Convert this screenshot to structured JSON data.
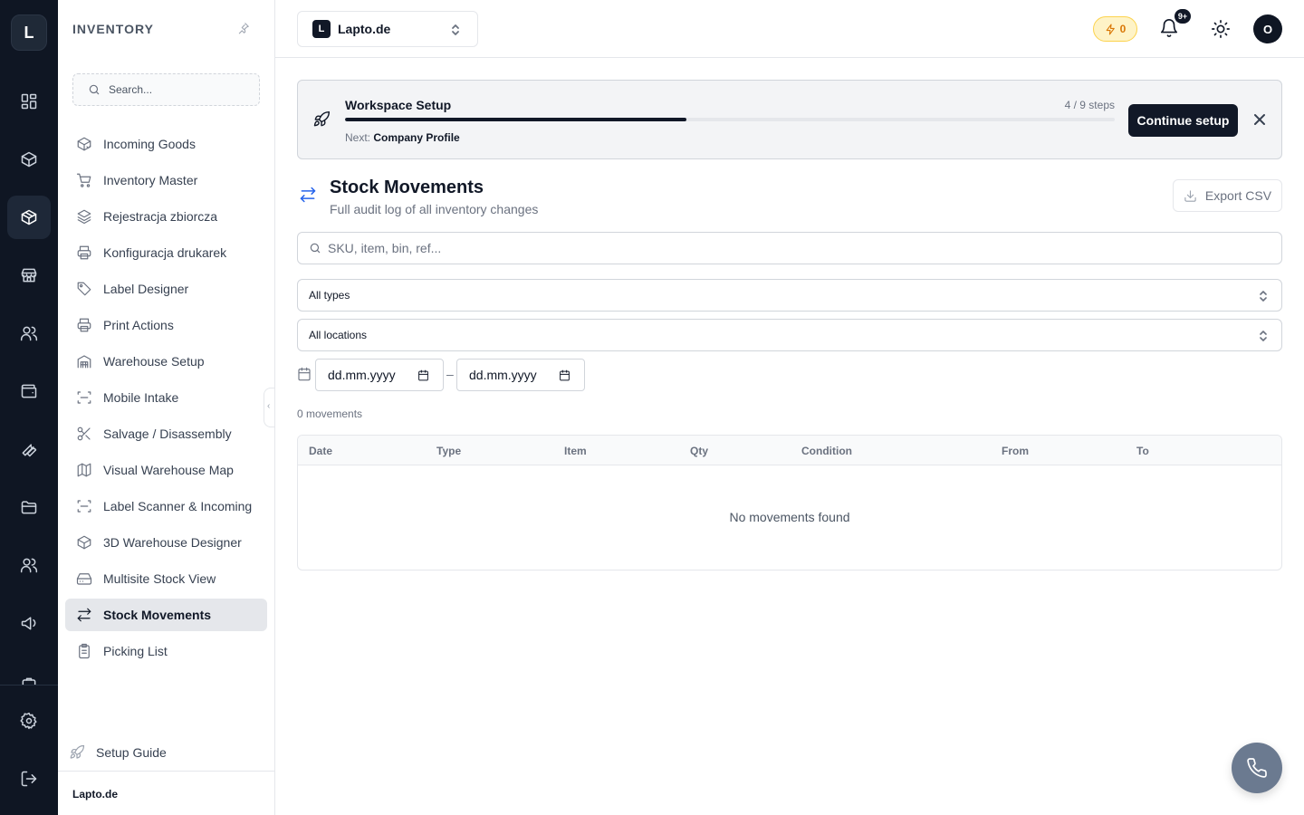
{
  "rail": {
    "logo_letter": "L",
    "items": [
      {
        "icon": "dashboard-icon"
      },
      {
        "icon": "box-icon"
      },
      {
        "icon": "inventory-box-icon",
        "active": true
      },
      {
        "icon": "store-icon"
      },
      {
        "icon": "users-icon"
      },
      {
        "icon": "wallet-icon"
      },
      {
        "icon": "wrench-icon"
      },
      {
        "icon": "folder-icon"
      },
      {
        "icon": "team-icon"
      },
      {
        "icon": "megaphone-icon"
      },
      {
        "icon": "settings-icon"
      },
      {
        "icon": "logout-icon"
      }
    ]
  },
  "sidebar": {
    "title": "INVENTORY",
    "search_placeholder": "Search...",
    "items": [
      {
        "label": "Incoming Goods",
        "icon": "package-incoming-icon"
      },
      {
        "label": "Inventory Master",
        "icon": "cart-icon"
      },
      {
        "label": "Rejestracja zbiorcza",
        "icon": "layers-icon"
      },
      {
        "label": "Konfiguracja drukarek",
        "icon": "printer-icon"
      },
      {
        "label": "Label Designer",
        "icon": "tag-icon"
      },
      {
        "label": "Print Actions",
        "icon": "printer-icon"
      },
      {
        "label": "Warehouse Setup",
        "icon": "building-icon"
      },
      {
        "label": "Mobile Intake",
        "icon": "scan-icon"
      },
      {
        "label": "Salvage / Disassembly",
        "icon": "scissors-icon"
      },
      {
        "label": "Visual Warehouse Map",
        "icon": "map-icon"
      },
      {
        "label": "Label Scanner & Incoming",
        "icon": "scan-icon"
      },
      {
        "label": "3D Warehouse Designer",
        "icon": "cube-icon"
      },
      {
        "label": "Multisite Stock View",
        "icon": "hard-drive-icon"
      },
      {
        "label": "Stock Movements",
        "icon": "arrows-left-right-icon",
        "active": true
      },
      {
        "label": "Picking List",
        "icon": "clipboard-list-icon"
      }
    ],
    "setup_guide": "Setup Guide",
    "footer_workspace": "Lapto.de"
  },
  "topbar": {
    "workspace_letter": "L",
    "workspace_name": "Lapto.de",
    "credits": "0",
    "notifications": "9+",
    "avatar_letter": "O"
  },
  "setup": {
    "title": "Workspace Setup",
    "steps_text": "4 / 9 steps",
    "progress": 0.444,
    "next_prefix": "Next:",
    "next_step": "Company Profile",
    "button": "Continue setup"
  },
  "page": {
    "title": "Stock Movements",
    "subtitle": "Full audit log of all inventory changes",
    "export_label": "Export CSV",
    "search_placeholder": "SKU, item, bin, ref...",
    "type_filter": "All types",
    "location_filter": "All locations",
    "date_from": "dd.mm.yyyy",
    "date_sep": "–",
    "date_to": "dd.mm.yyyy",
    "count_text": "0 movements",
    "columns": [
      "Date",
      "Type",
      "Item",
      "Qty",
      "Condition",
      "From",
      "To"
    ],
    "empty_text": "No movements found"
  },
  "colors": {
    "rail_bg": "#0f1623",
    "accent_blue": "#2563eb",
    "primary_dark": "#111827",
    "credit_amber": "#d97706"
  }
}
